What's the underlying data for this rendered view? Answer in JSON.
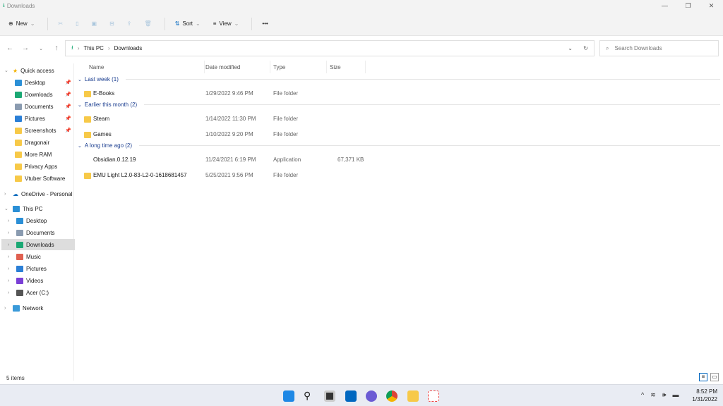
{
  "window": {
    "title": "Downloads",
    "minimize": "—",
    "restore": "❐",
    "close": "✕"
  },
  "toolbar": {
    "new": "New",
    "sort": "Sort",
    "view": "View",
    "more": "•••"
  },
  "address": {
    "path": [
      "This PC",
      "Downloads"
    ],
    "search_placeholder": "Search Downloads"
  },
  "sidebar": {
    "quick_access": "Quick access",
    "quick_items": [
      {
        "label": "Desktop",
        "icon": "desktop",
        "pinned": true
      },
      {
        "label": "Downloads",
        "icon": "download",
        "pinned": true
      },
      {
        "label": "Documents",
        "icon": "documents",
        "pinned": true
      },
      {
        "label": "Pictures",
        "icon": "pictures",
        "pinned": true
      },
      {
        "label": "Screenshots",
        "icon": "folder",
        "pinned": true
      },
      {
        "label": "Dragonair",
        "icon": "folder"
      },
      {
        "label": "More RAM",
        "icon": "folder"
      },
      {
        "label": "Privacy Apps",
        "icon": "folder"
      },
      {
        "label": "Vtuber Software",
        "icon": "folder"
      }
    ],
    "onedrive": "OneDrive - Personal",
    "this_pc": "This PC",
    "pc_items": [
      {
        "label": "Desktop"
      },
      {
        "label": "Documents"
      },
      {
        "label": "Downloads",
        "selected": true
      },
      {
        "label": "Music"
      },
      {
        "label": "Pictures"
      },
      {
        "label": "Videos"
      },
      {
        "label": "Acer (C:)"
      }
    ],
    "network": "Network"
  },
  "columns": {
    "name": "Name",
    "date": "Date modified",
    "type": "Type",
    "size": "Size"
  },
  "groups": [
    {
      "label": "Last week (1)",
      "files": [
        {
          "name": "E-Books",
          "date": "1/29/2022 9:46 PM",
          "type": "File folder",
          "size": ""
        }
      ]
    },
    {
      "label": "Earlier this month (2)",
      "files": [
        {
          "name": "Steam",
          "date": "1/14/2022 11:30 PM",
          "type": "File folder",
          "size": ""
        },
        {
          "name": "Games",
          "date": "1/10/2022 9:20 PM",
          "type": "File folder",
          "size": ""
        }
      ]
    },
    {
      "label": "A long time ago (2)",
      "files": [
        {
          "name": "Obsidian.0.12.19",
          "date": "11/24/2021 6:19 PM",
          "type": "Application",
          "size": "67,371 KB"
        },
        {
          "name": "EMU Light L2.0-83-L2-0-1618681457",
          "date": "5/25/2021 9:56 PM",
          "type": "File folder",
          "size": ""
        }
      ]
    }
  ],
  "status": {
    "items": "5 items"
  },
  "taskbar": {
    "time": "8:52 PM",
    "date": "1/31/2022"
  },
  "colors": {
    "folder": "#f7c948",
    "accent": "#0067c0",
    "download": "#1ba874"
  }
}
